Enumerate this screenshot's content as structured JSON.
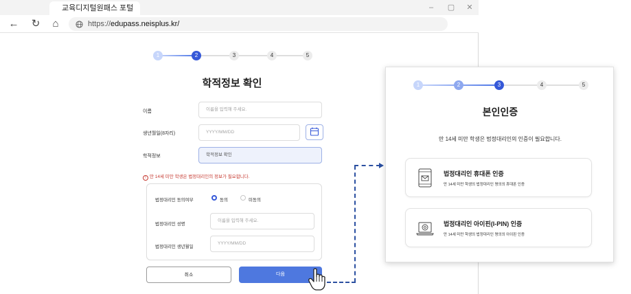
{
  "browser": {
    "tab_title": "교육디지털원패스 포털",
    "url_scheme": "https://",
    "url_host": "edupass.neisplus.kr/",
    "controls": {
      "minimize": "–",
      "restore": "▢",
      "close": "✕"
    },
    "nav": {
      "back": "←",
      "refresh": "↻",
      "home": "⌂"
    }
  },
  "form": {
    "steps": [
      "1",
      "2",
      "3",
      "4",
      "5"
    ],
    "current_step": 2,
    "title": "학적정보 확인",
    "fields": {
      "name_label": "이름",
      "name_placeholder": "이름을 입력해 주세요.",
      "birth_label": "생년월일(8자리)",
      "birth_placeholder": "YYYY/MM/DD",
      "school_label": "학적정보",
      "school_value": "학적정보 확인"
    },
    "warning": "만 14세 미만 학생은 법정대리인의 정보가 필요합니다.",
    "warning_icon": "!",
    "guardian": {
      "consent_label": "법정대리인 동의여부",
      "agree": "동의",
      "disagree": "미동의",
      "name_label": "법정대리인 성명",
      "name_placeholder": "이름을 입력해 주세요.",
      "birth_label": "법정대리인 생년월일",
      "birth_placeholder": "YYYY/MM/DD"
    },
    "cancel": "취소",
    "next": "다음"
  },
  "panel": {
    "steps": [
      "1",
      "2",
      "3",
      "4",
      "5"
    ],
    "current_step": 3,
    "title": "본인인증",
    "subtitle": "만 14세 미만 학생은 법정대리인의 인증이 필요합니다.",
    "options": [
      {
        "title": "법정대리인 휴대폰 인증",
        "desc": "만 14세 미만 학생의 법정대리인 명의의 휴대폰 인증",
        "icon": "mobile-phone-icon"
      },
      {
        "title": "법정대리인 아이핀(I-PIN) 인증",
        "desc": "만 14세 미만 학생의 법정대리인 명의의 아이핀 인증",
        "icon": "laptop-ipin-icon"
      }
    ]
  },
  "colors": {
    "accent": "#3558d8",
    "button": "#4e78df",
    "warning": "#c63a31",
    "connector": "#2a4fa0"
  }
}
